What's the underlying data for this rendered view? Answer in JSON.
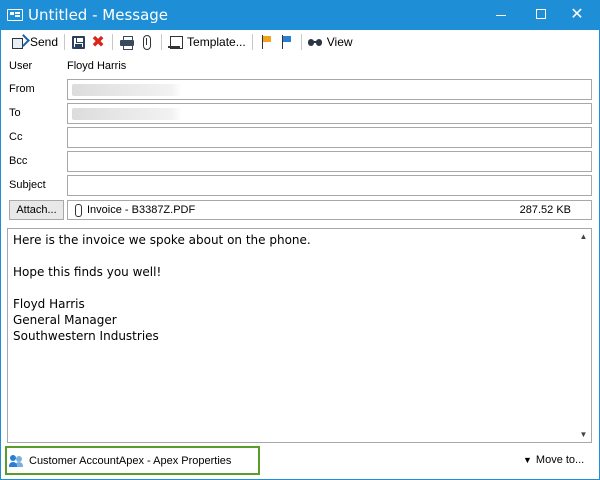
{
  "window": {
    "title": "Untitled - Message",
    "accent": "#1e8fd6"
  },
  "toolbar": {
    "send_label": "Send",
    "template_label": "Template...",
    "view_label": "View",
    "icons": [
      "send-icon",
      "save-icon",
      "delete-icon",
      "print-icon",
      "paperclip-icon",
      "template-icon",
      "flag-orange-icon",
      "flag-blue-icon",
      "binoculars-icon"
    ]
  },
  "header": {
    "user_label": "User",
    "user_value": "Floyd Harris",
    "from_label": "From",
    "to_label": "To",
    "cc_label": "Cc",
    "bcc_label": "Bcc",
    "subject_label": "Subject",
    "cc_value": "",
    "bcc_value": "",
    "subject_value": ""
  },
  "attachments": {
    "button_label": "Attach...",
    "items": [
      {
        "name": "Invoice - B3387Z.PDF",
        "size": "287.52 KB"
      }
    ]
  },
  "body": {
    "text": "Here is the invoice we spoke about on the phone.\n\nHope this finds you well!\n\nFloyd Harris\nGeneral Manager\nSouthwestern Industries"
  },
  "footer": {
    "account_label": "Customer Account",
    "account_name": "Apex - Apex Properties",
    "move_to_label": "Move to...",
    "highlight_color": "#5a9e2a"
  }
}
